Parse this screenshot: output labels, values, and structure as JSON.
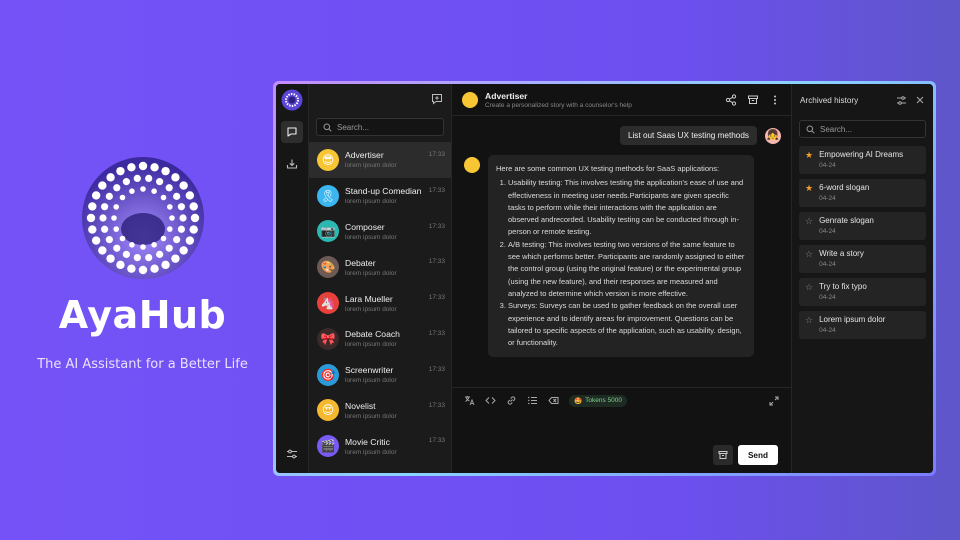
{
  "brand": {
    "name": "AyaHub",
    "tagline": "The AI Assistant for a Better Life",
    "accent": "#7452f7"
  },
  "list": {
    "search_placeholder": "Search...",
    "new_chat_icon": "message-plus-icon",
    "assistants": [
      {
        "name": "Advertiser",
        "sub": "lorem ipsum dolor",
        "time": "17:33",
        "active": true,
        "color": "#f8c635",
        "emoji": "😎"
      },
      {
        "name": "Stand-up Comedian",
        "sub": "lorem ipsum dolor",
        "time": "17:33",
        "color": "#3bb6f0",
        "emoji": "🎗"
      },
      {
        "name": "Composer",
        "sub": "lorem ipsum dolor",
        "time": "17:33",
        "color": "#2ab8b0",
        "emoji": "📷"
      },
      {
        "name": "Debater",
        "sub": "lorem ipsum dolor",
        "time": "17:33",
        "color": "#6b5a55",
        "emoji": "🎨"
      },
      {
        "name": "Lara Mueller",
        "sub": "lorem ipsum dolor",
        "time": "17:33",
        "color": "#e8403a",
        "emoji": "🦄"
      },
      {
        "name": "Debate Coach",
        "sub": "lorem ipsum dolor",
        "time": "17:33",
        "color": "#3a2a2a",
        "emoji": "🎀"
      },
      {
        "name": "Screenwriter",
        "sub": "lorem ipsum dolor",
        "time": "17:33",
        "color": "#2a9bd8",
        "emoji": "🎯"
      },
      {
        "name": "Novelist",
        "sub": "lorem ipsum dolor",
        "time": "17:33",
        "color": "#f5b82e",
        "emoji": "😍"
      },
      {
        "name": "Movie Critic",
        "sub": "lorem ipsum dolor",
        "time": "17:33",
        "color": "#7a5af5",
        "emoji": "🎬"
      }
    ]
  },
  "chat": {
    "title": "Advertiser",
    "subtitle": "Create a personalized story with a counselor's help",
    "user_message": "List out Saas UX testing methods",
    "bot_intro": "Here are some common UX testing methods for SaaS applications:",
    "bot_items": [
      "Usability testing: This involves testing the application's ease of use and effectiveness in meeting user needs.Participants are given specific tasks to perform while their interactions with the application are observed andrecorded. Usability testing can be conducted through in-person or remote testing.",
      "A/B testing: This involves testing two versions of the same feature to see which performs better. Participants are randomly assigned to either the control group (using the original feature) or the experimental group (using the new feature), and their responses are measured and analyzed to determine which version is more effective.",
      "Surveys: Surveys can be used to gather feedback on the overall user experience and to identify areas for improvement. Questions can be tailored to specific aspects of the application, such as usability. design, or functionality."
    ],
    "tokens_label": "Tokens 5000",
    "send_label": "Send"
  },
  "history": {
    "title": "Archived history",
    "search_placeholder": "Search...",
    "items": [
      {
        "name": "Empowering AI Dreams",
        "date": "04-24",
        "starred": true
      },
      {
        "name": "6-word slogan",
        "date": "04-24",
        "starred": true
      },
      {
        "name": "Genrate slogan",
        "date": "04-24",
        "starred": false
      },
      {
        "name": "Write a story",
        "date": "04-24",
        "starred": false
      },
      {
        "name": "Try to fix typo",
        "date": "04-24",
        "starred": false
      },
      {
        "name": "Lorem ipsum dolor",
        "date": "04-24",
        "starred": false
      }
    ]
  }
}
